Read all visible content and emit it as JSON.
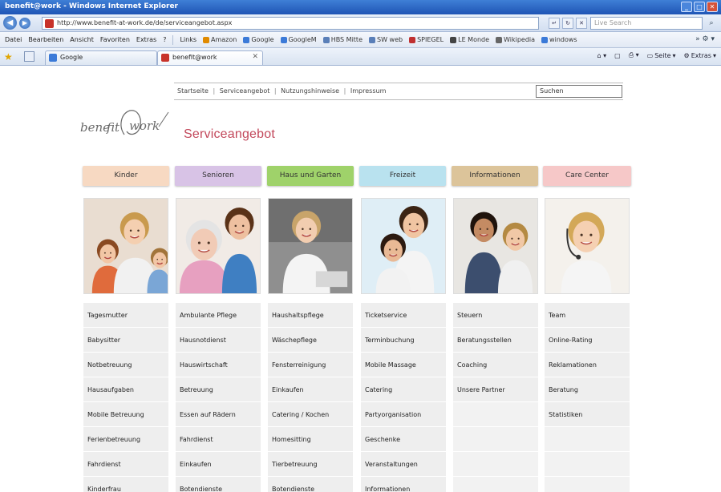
{
  "window": {
    "title": "benefit@work - Windows Internet Explorer"
  },
  "address": {
    "url": "http://www.benefit-at-work.de/de/serviceangebot.aspx",
    "search_placeholder": "Live Search"
  },
  "menu": {
    "items": [
      "Datei",
      "Bearbeiten",
      "Ansicht",
      "Favoriten",
      "Extras",
      "?"
    ],
    "links_label": "Links",
    "links": [
      {
        "label": "Amazon",
        "color": "#e08a00"
      },
      {
        "label": "Google",
        "color": "#3b7ad8"
      },
      {
        "label": "GoogleM",
        "color": "#3b7ad8"
      },
      {
        "label": "HBS Mitte",
        "color": "#5a7fb8"
      },
      {
        "label": "SW web",
        "color": "#5a7fb8"
      },
      {
        "label": "SPIEGEL",
        "color": "#c03030"
      },
      {
        "label": "LE Monde",
        "color": "#444444"
      },
      {
        "label": "Wikipedia",
        "color": "#666666"
      },
      {
        "label": "windows",
        "color": "#3b7ad8"
      }
    ]
  },
  "tabs": {
    "inactive": {
      "label": "Google",
      "favicon_color": "#3b7ad8"
    },
    "active": {
      "label": "benefit@work",
      "favicon_color": "#c8332a"
    }
  },
  "command_bar": {
    "page": "Seite",
    "tools": "Extras"
  },
  "site": {
    "topnav": [
      "Startseite",
      "Serviceangebot",
      "Nutzungshinweise",
      "Impressum"
    ],
    "search_value": "Suchen",
    "logo_text": "benefit@work",
    "page_title": "Serviceangebot",
    "categories": [
      {
        "label": "Kinder",
        "color": "#f7d9c2",
        "icon": "children-photo",
        "services": [
          "Tagesmutter",
          "Babysitter",
          "Notbetreuung",
          "Hausaufgaben",
          "Mobile Betreuung",
          "Ferienbetreuung",
          "Fahrdienst",
          "Kinderfrau"
        ]
      },
      {
        "label": "Senioren",
        "color": "#d8c3e6",
        "icon": "seniors-photo",
        "services": [
          "Ambulante Pflege",
          "Hausnotdienst",
          "Hauswirtschaft",
          "Betreuung",
          "Essen auf Rädern",
          "Fahrdienst",
          "Einkaufen",
          "Botendienste"
        ]
      },
      {
        "label": "Haus und Garten",
        "color": "#9fd26a",
        "icon": "household-photo",
        "services": [
          "Haushaltspflege",
          "Wäschepflege",
          "Fensterreinigung",
          "Einkaufen",
          "Catering / Kochen",
          "Homesitting",
          "Tierbetreuung",
          "Botendienste"
        ]
      },
      {
        "label": "Freizeit",
        "color": "#b9e2ef",
        "icon": "leisure-photo",
        "services": [
          "Ticketservice",
          "Terminbuchung",
          "Mobile Massage",
          "Catering",
          "Partyorganisation",
          "Geschenke",
          "Veranstaltungen",
          "Informationen"
        ]
      },
      {
        "label": "Informationen",
        "color": "#dcc49a",
        "icon": "information-photo",
        "services": [
          "Steuern",
          "Beratungsstellen",
          "Coaching",
          "Unsere Partner"
        ]
      },
      {
        "label": "Care Center",
        "color": "#f6c8c8",
        "icon": "care-center-photo",
        "services": [
          "Team",
          "Online-Rating",
          "Reklamationen",
          "Beratung",
          "Statistiken"
        ]
      }
    ]
  }
}
